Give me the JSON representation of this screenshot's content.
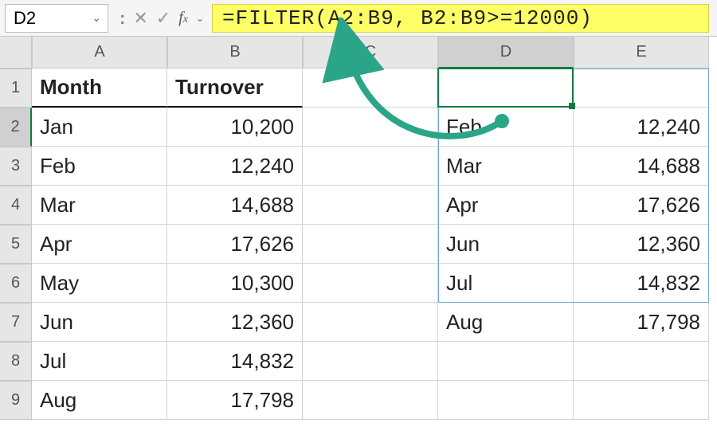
{
  "name_box": {
    "value": "D2"
  },
  "formula_bar": {
    "formula": "=FILTER(A2:B9, B2:B9>=12000)"
  },
  "columns": [
    "A",
    "B",
    "C",
    "D",
    "E"
  ],
  "rows": [
    "1",
    "2",
    "3",
    "4",
    "5",
    "6",
    "7",
    "8",
    "9"
  ],
  "headers": {
    "month": "Month",
    "turnover": "Turnover"
  },
  "source": [
    {
      "month": "Jan",
      "turnover": "10,200"
    },
    {
      "month": "Feb",
      "turnover": "12,240"
    },
    {
      "month": "Mar",
      "turnover": "14,688"
    },
    {
      "month": "Apr",
      "turnover": "17,626"
    },
    {
      "month": "May",
      "turnover": "10,300"
    },
    {
      "month": "Jun",
      "turnover": "12,360"
    },
    {
      "month": "Jul",
      "turnover": "14,832"
    },
    {
      "month": "Aug",
      "turnover": "17,798"
    }
  ],
  "result": [
    {
      "month": "Feb",
      "turnover": "12,240"
    },
    {
      "month": "Mar",
      "turnover": "14,688"
    },
    {
      "month": "Apr",
      "turnover": "17,626"
    },
    {
      "month": "Jun",
      "turnover": "12,360"
    },
    {
      "month": "Jul",
      "turnover": "14,832"
    },
    {
      "month": "Aug",
      "turnover": "17,798"
    }
  ],
  "icons": {
    "chevron_down": "⌄",
    "cancel": "✕",
    "enter": "✓",
    "dots": ":"
  }
}
